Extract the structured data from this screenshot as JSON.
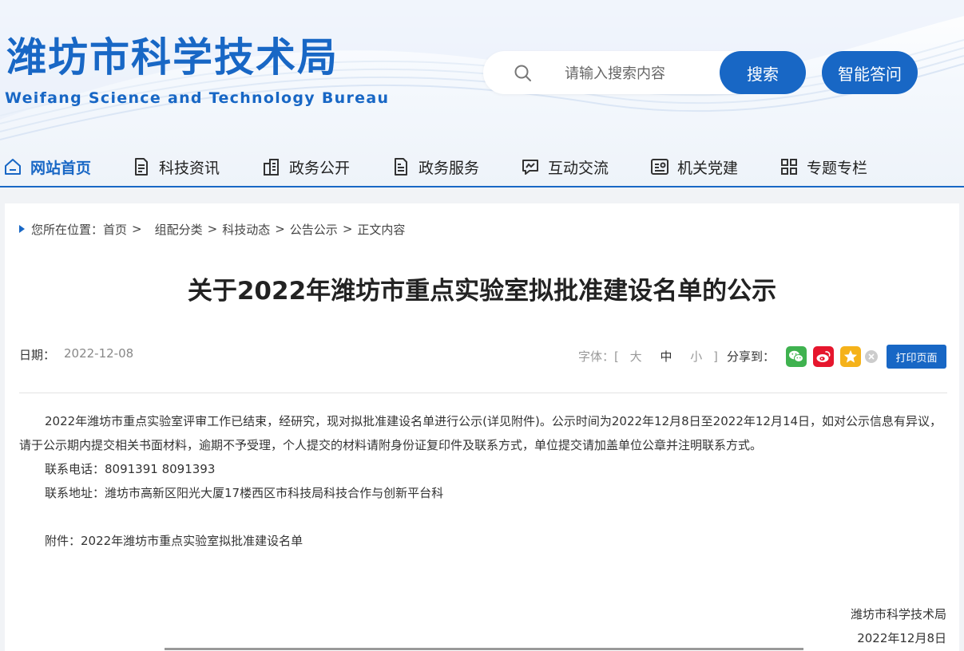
{
  "header": {
    "title": "潍坊市科学技术局",
    "subtitle": "Weifang Science and Technology Bureau"
  },
  "search": {
    "placeholder": "请输入搜索内容",
    "button_label": "搜索",
    "qa_label": "智能答问"
  },
  "nav": {
    "items": [
      {
        "label": "网站首页",
        "icon": "home-icon",
        "active": true
      },
      {
        "label": "科技资讯",
        "icon": "document-icon"
      },
      {
        "label": "政务公开",
        "icon": "building-icon"
      },
      {
        "label": "政务服务",
        "icon": "service-doc-icon"
      },
      {
        "label": "互动交流",
        "icon": "chat-icon"
      },
      {
        "label": "机关党建",
        "icon": "party-icon"
      },
      {
        "label": "专题专栏",
        "icon": "grid-icon"
      }
    ]
  },
  "breadcrumb": {
    "prefix": "您所在位置：",
    "items": [
      "首页",
      "组配分类",
      "科技动态",
      "公告公示",
      "正文内容"
    ],
    "separator": ">"
  },
  "article": {
    "title": "关于2022年潍坊市重点实验室拟批准建设名单的公示",
    "date_label": "日期：",
    "date": "2022-12-08",
    "font_label": "字体：[",
    "font_sizes": [
      "大",
      "中",
      "小"
    ],
    "font_close": "]",
    "share_label": "分享到：",
    "print_label": "打印页面",
    "paragraph1": "2022年潍坊市重点实验室评审工作已结束，经研究，现对拟批准建设名单进行公示(详见附件)。公示时间为2022年12月8日至2022年12月14日，如对公示信息有异议，请于公示期内提交相关书面材料，逾期不予受理，个人提交的材料请附身份证复印件及联系方式，单位提交请加盖单位公章并注明联系方式。",
    "phone": "联系电话：8091391 8091393",
    "address": "联系地址：潍坊市高新区阳光大厦17楼西区市科技局科技合作与创新平台科",
    "attachment": "附件：2022年潍坊市重点实验室拟批准建设名单",
    "signature_org": "潍坊市科学技术局",
    "signature_date": "2022年12月8日"
  },
  "colors": {
    "brand": "#1867c5",
    "wechat": "#3fb24f",
    "weibo": "#e6162d",
    "qzone": "#f5b21a"
  }
}
